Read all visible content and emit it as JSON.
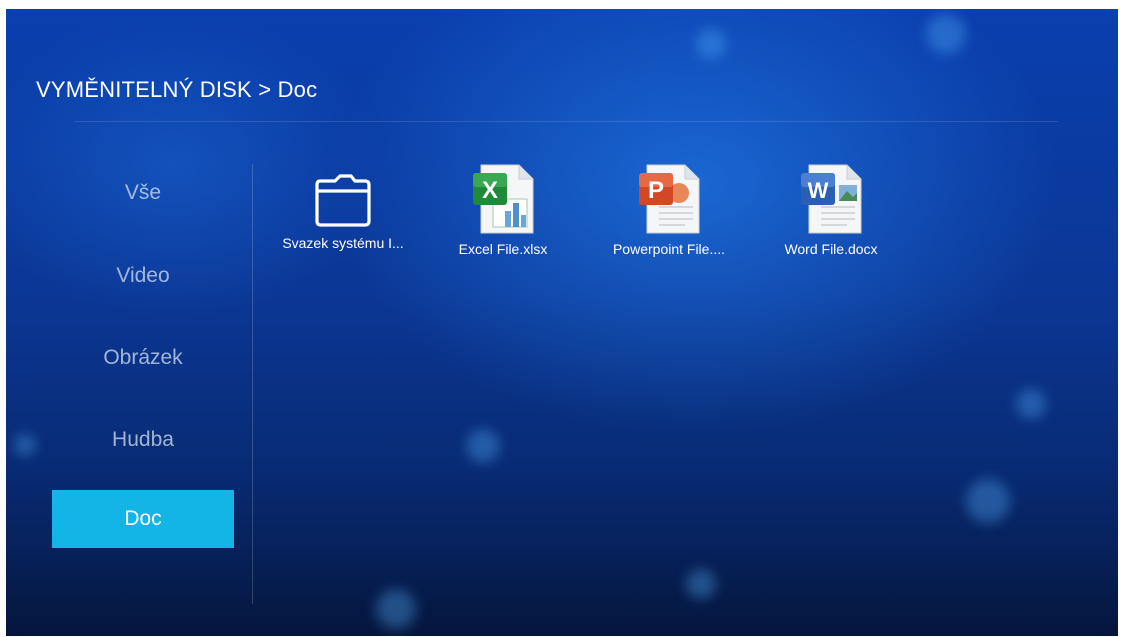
{
  "header": {
    "title": "VYMĚNITELNÝ DISK > Doc"
  },
  "sidebar": {
    "items": [
      {
        "label": "Vše",
        "active": false
      },
      {
        "label": "Video",
        "active": false
      },
      {
        "label": "Obrázek",
        "active": false
      },
      {
        "label": "Hudba",
        "active": false
      },
      {
        "label": "Doc",
        "active": true
      }
    ]
  },
  "files": [
    {
      "name": "Svazek systému I...",
      "icon": "folder-icon"
    },
    {
      "name": "Excel File.xlsx",
      "icon": "excel-file-icon"
    },
    {
      "name": "Powerpoint File....",
      "icon": "powerpoint-file-icon"
    },
    {
      "name": "Word File.docx",
      "icon": "word-file-icon"
    }
  ],
  "colors": {
    "background": "#0b3796",
    "active_item": "#13b4e6",
    "excel": "#1f8a3a",
    "powerpoint": "#d24726",
    "word": "#2b5eb5"
  }
}
